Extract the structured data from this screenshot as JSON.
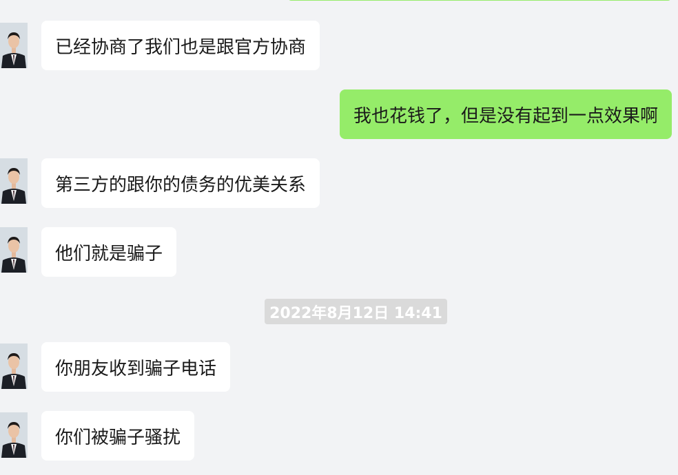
{
  "messages": [
    {
      "side": "in",
      "text": "已经协商了我们也是跟官方协商"
    },
    {
      "side": "out",
      "text": "我也花钱了，但是没有起到一点效果啊"
    },
    {
      "side": "in",
      "text": "第三方的跟你的债务的优美关系"
    },
    {
      "side": "in",
      "text": "他们就是骗子"
    },
    {
      "side": "in",
      "text": "你朋友收到骗子电话"
    },
    {
      "side": "in",
      "text": "你们被骗子骚扰"
    }
  ],
  "timestamp": "2022年8月12日 14:41",
  "colors": {
    "background": "#f2f3f5",
    "incoming_bubble": "#ffffff",
    "outgoing_bubble": "#95ec69",
    "timestamp_bg": "#dadada"
  },
  "icons": {
    "contact_avatar": "avatar-man-in-suit-icon"
  }
}
